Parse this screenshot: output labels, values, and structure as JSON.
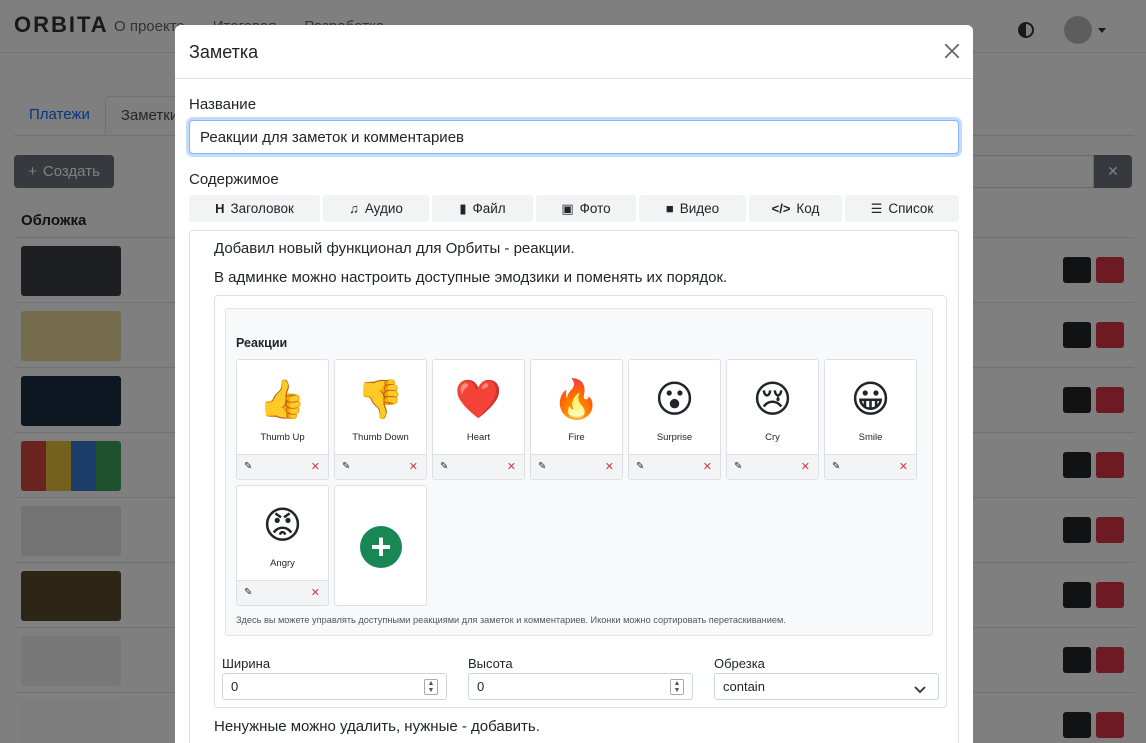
{
  "background": {
    "logo": "ORBITA",
    "nav_links": [
      "О проекте",
      "Итоговая",
      "Разработка"
    ],
    "tabs": [
      "Платежи",
      "Заметки"
    ],
    "create_button": "Создать",
    "column_header": "Обложка",
    "row_count": 8
  },
  "modal": {
    "title": "Заметка",
    "name_label": "Название",
    "name_value": "Реакции для заметок и комментариев",
    "content_label": "Содержимое",
    "toolbar": [
      {
        "icon": "H",
        "label": "Заголовок",
        "name": "heading"
      },
      {
        "icon": "♫",
        "label": "Аудио",
        "name": "audio"
      },
      {
        "icon": "▮",
        "label": "Файл",
        "name": "file"
      },
      {
        "icon": "▣",
        "label": "Фото",
        "name": "photo"
      },
      {
        "icon": "■",
        "label": "Видео",
        "name": "video"
      },
      {
        "icon": "</>",
        "label": "Код",
        "name": "code"
      },
      {
        "icon": "☰",
        "label": "Список",
        "name": "list"
      }
    ],
    "para1": "Добавил новый функционал для Орбиты - реакции.",
    "para2": "В админке можно настроить доступные эмодзики и поменять их порядок.",
    "para3": "Ненужные можно удалить, нужные - добавить.",
    "embedded": {
      "title": "Реакции",
      "reactions": [
        {
          "emoji": "👍",
          "name": "Thumb Up"
        },
        {
          "emoji": "👎",
          "name": "Thumb Down"
        },
        {
          "emoji": "❤️",
          "name": "Heart"
        },
        {
          "emoji": "🔥",
          "name": "Fire"
        },
        {
          "emoji": "😮",
          "name": "Surprise"
        },
        {
          "emoji": "😢",
          "name": "Cry"
        },
        {
          "emoji": "😀",
          "name": "Smile"
        },
        {
          "emoji": "😡",
          "name": "Angry"
        }
      ],
      "hint": "Здесь вы можете управлять доступными реакциями для заметок и комментариев. Иконки можно сортировать перетаскиванием."
    },
    "width_label": "Ширина",
    "width_value": "0",
    "height_label": "Высота",
    "height_value": "0",
    "crop_label": "Обрезка",
    "crop_value": "contain"
  }
}
